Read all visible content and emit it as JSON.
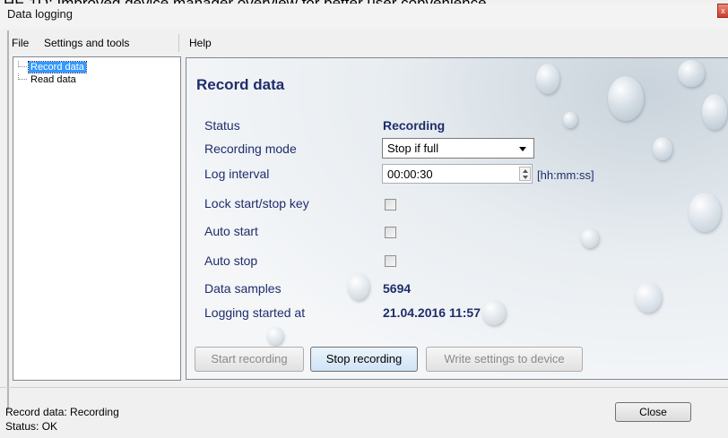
{
  "caption": "HE 1D: Improved device manager overview for better user convenience",
  "window": {
    "title": "Data logging",
    "close_glyph": "x"
  },
  "menu": {
    "items": [
      "File",
      "Settings and tools",
      "Help"
    ]
  },
  "tree": {
    "items": [
      {
        "label": "Record data",
        "selected": true
      },
      {
        "label": "Read data",
        "selected": false
      }
    ]
  },
  "panel": {
    "title": "Record data",
    "status_label": "Status",
    "status_value": "Recording",
    "recording_mode_label": "Recording mode",
    "recording_mode_value": "Stop if full",
    "log_interval_label": "Log interval",
    "log_interval_value": "00:00:30",
    "log_interval_unit": "[hh:mm:ss]",
    "lock_key_label": "Lock start/stop key",
    "lock_key_checked": false,
    "auto_start_label": "Auto start",
    "auto_start_checked": false,
    "auto_stop_label": "Auto stop",
    "auto_stop_checked": false,
    "data_samples_label": "Data samples",
    "data_samples_value": "5694",
    "logging_started_label": "Logging started at",
    "logging_started_value": "21.04.2016 11:57"
  },
  "buttons": {
    "start": "Start recording",
    "stop": "Stop recording",
    "write": "Write settings to device"
  },
  "status": {
    "line1": "Record data: Recording",
    "line2": "Status: OK"
  },
  "footer": {
    "close": "Close"
  }
}
